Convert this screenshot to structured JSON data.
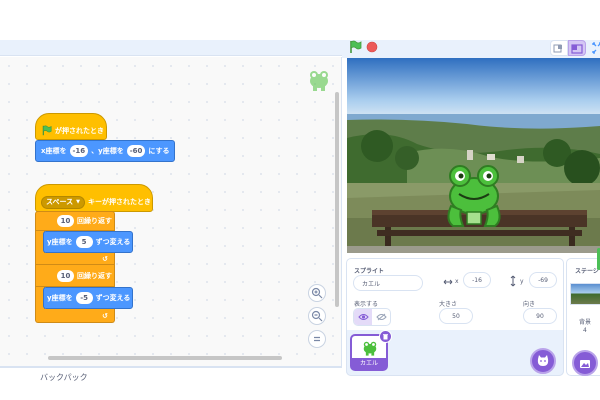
{
  "code": {
    "when_flag": "が押されたとき",
    "goto_x": "x座標を",
    "goto_x_val": "-16",
    "goto_sep": "、y座標を",
    "goto_y_val": "-60",
    "goto_tail": "にする",
    "key_option": "スペース",
    "when_key": "キーが押されたとき",
    "repeat1_val": "10",
    "repeat1_label": "回繰り返す",
    "change1_label": "y座標を",
    "change1_val": "5",
    "change1_tail": "ずつ変える",
    "repeat2_val": "10",
    "repeat2_label": "回繰り返す",
    "change2_label": "y座標を",
    "change2_val": "-5",
    "change2_tail": "ずつ変える"
  },
  "backpack": {
    "label": "バックパック"
  },
  "sprite_info": {
    "sprite_label": "スプライト",
    "sprite_name": "カエル",
    "x_label": "x",
    "x_val": "-16",
    "y_label": "y",
    "y_val": "-69",
    "show_label": "表示する",
    "size_label": "大きさ",
    "size_val": "50",
    "direction_label": "向き",
    "direction_val": "90"
  },
  "sprite_list": [
    {
      "name": "カエル"
    }
  ],
  "stage_pane": {
    "label": "ステージ",
    "backdrop_label": "背景",
    "backdrop_count": "4"
  },
  "colors": {
    "events": "#ffbf00",
    "motion": "#4c97ff",
    "control": "#ffab19",
    "accent": "#855cd6",
    "frog": "#4cbf3c"
  }
}
